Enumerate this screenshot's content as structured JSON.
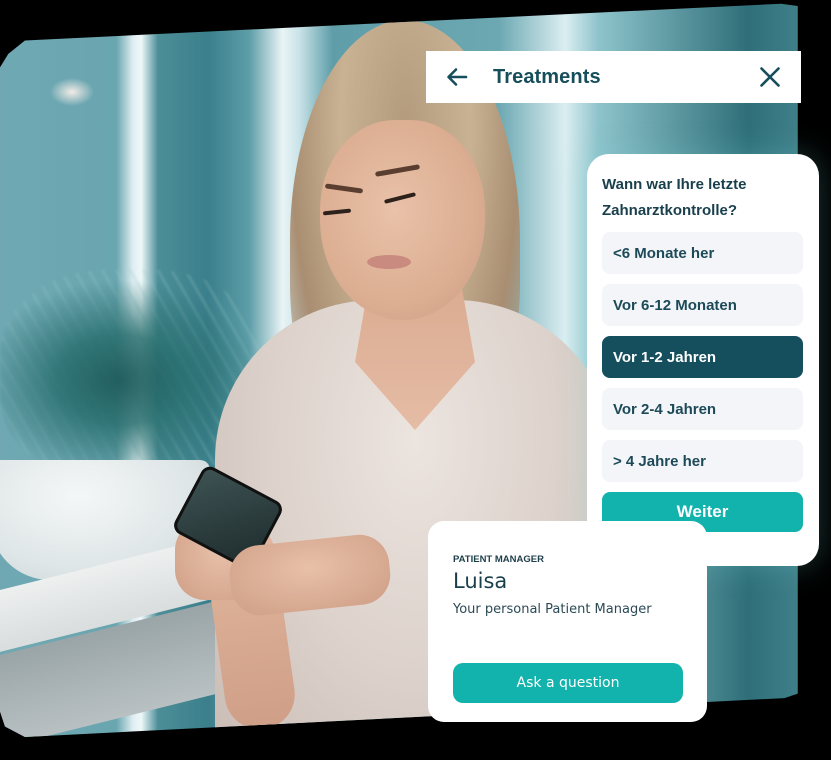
{
  "header": {
    "title": "Treatments",
    "back_icon": "arrow-left-icon",
    "close_icon": "close-x-icon"
  },
  "question_card": {
    "question": "Wann war Ihre letzte Zahnarztkontrolle?",
    "options": [
      {
        "label": "<6 Monate her",
        "selected": false
      },
      {
        "label": "Vor 6-12 Monaten",
        "selected": false
      },
      {
        "label": "Vor 1-2 Jahren",
        "selected": true
      },
      {
        "label": "Vor 2-4 Jahren",
        "selected": false
      },
      {
        "label": "> 4 Jahre her",
        "selected": false
      }
    ],
    "submit_label": "Weiter"
  },
  "patient_card": {
    "eyebrow": "PATIENT MANAGER",
    "name": "Luisa",
    "subtitle": "Your personal Patient Manager",
    "button_label": "Ask a question"
  },
  "colors": {
    "brand_dark": "#154f5e",
    "accent_teal": "#12b3ac",
    "option_bg": "#f3f5f8"
  }
}
